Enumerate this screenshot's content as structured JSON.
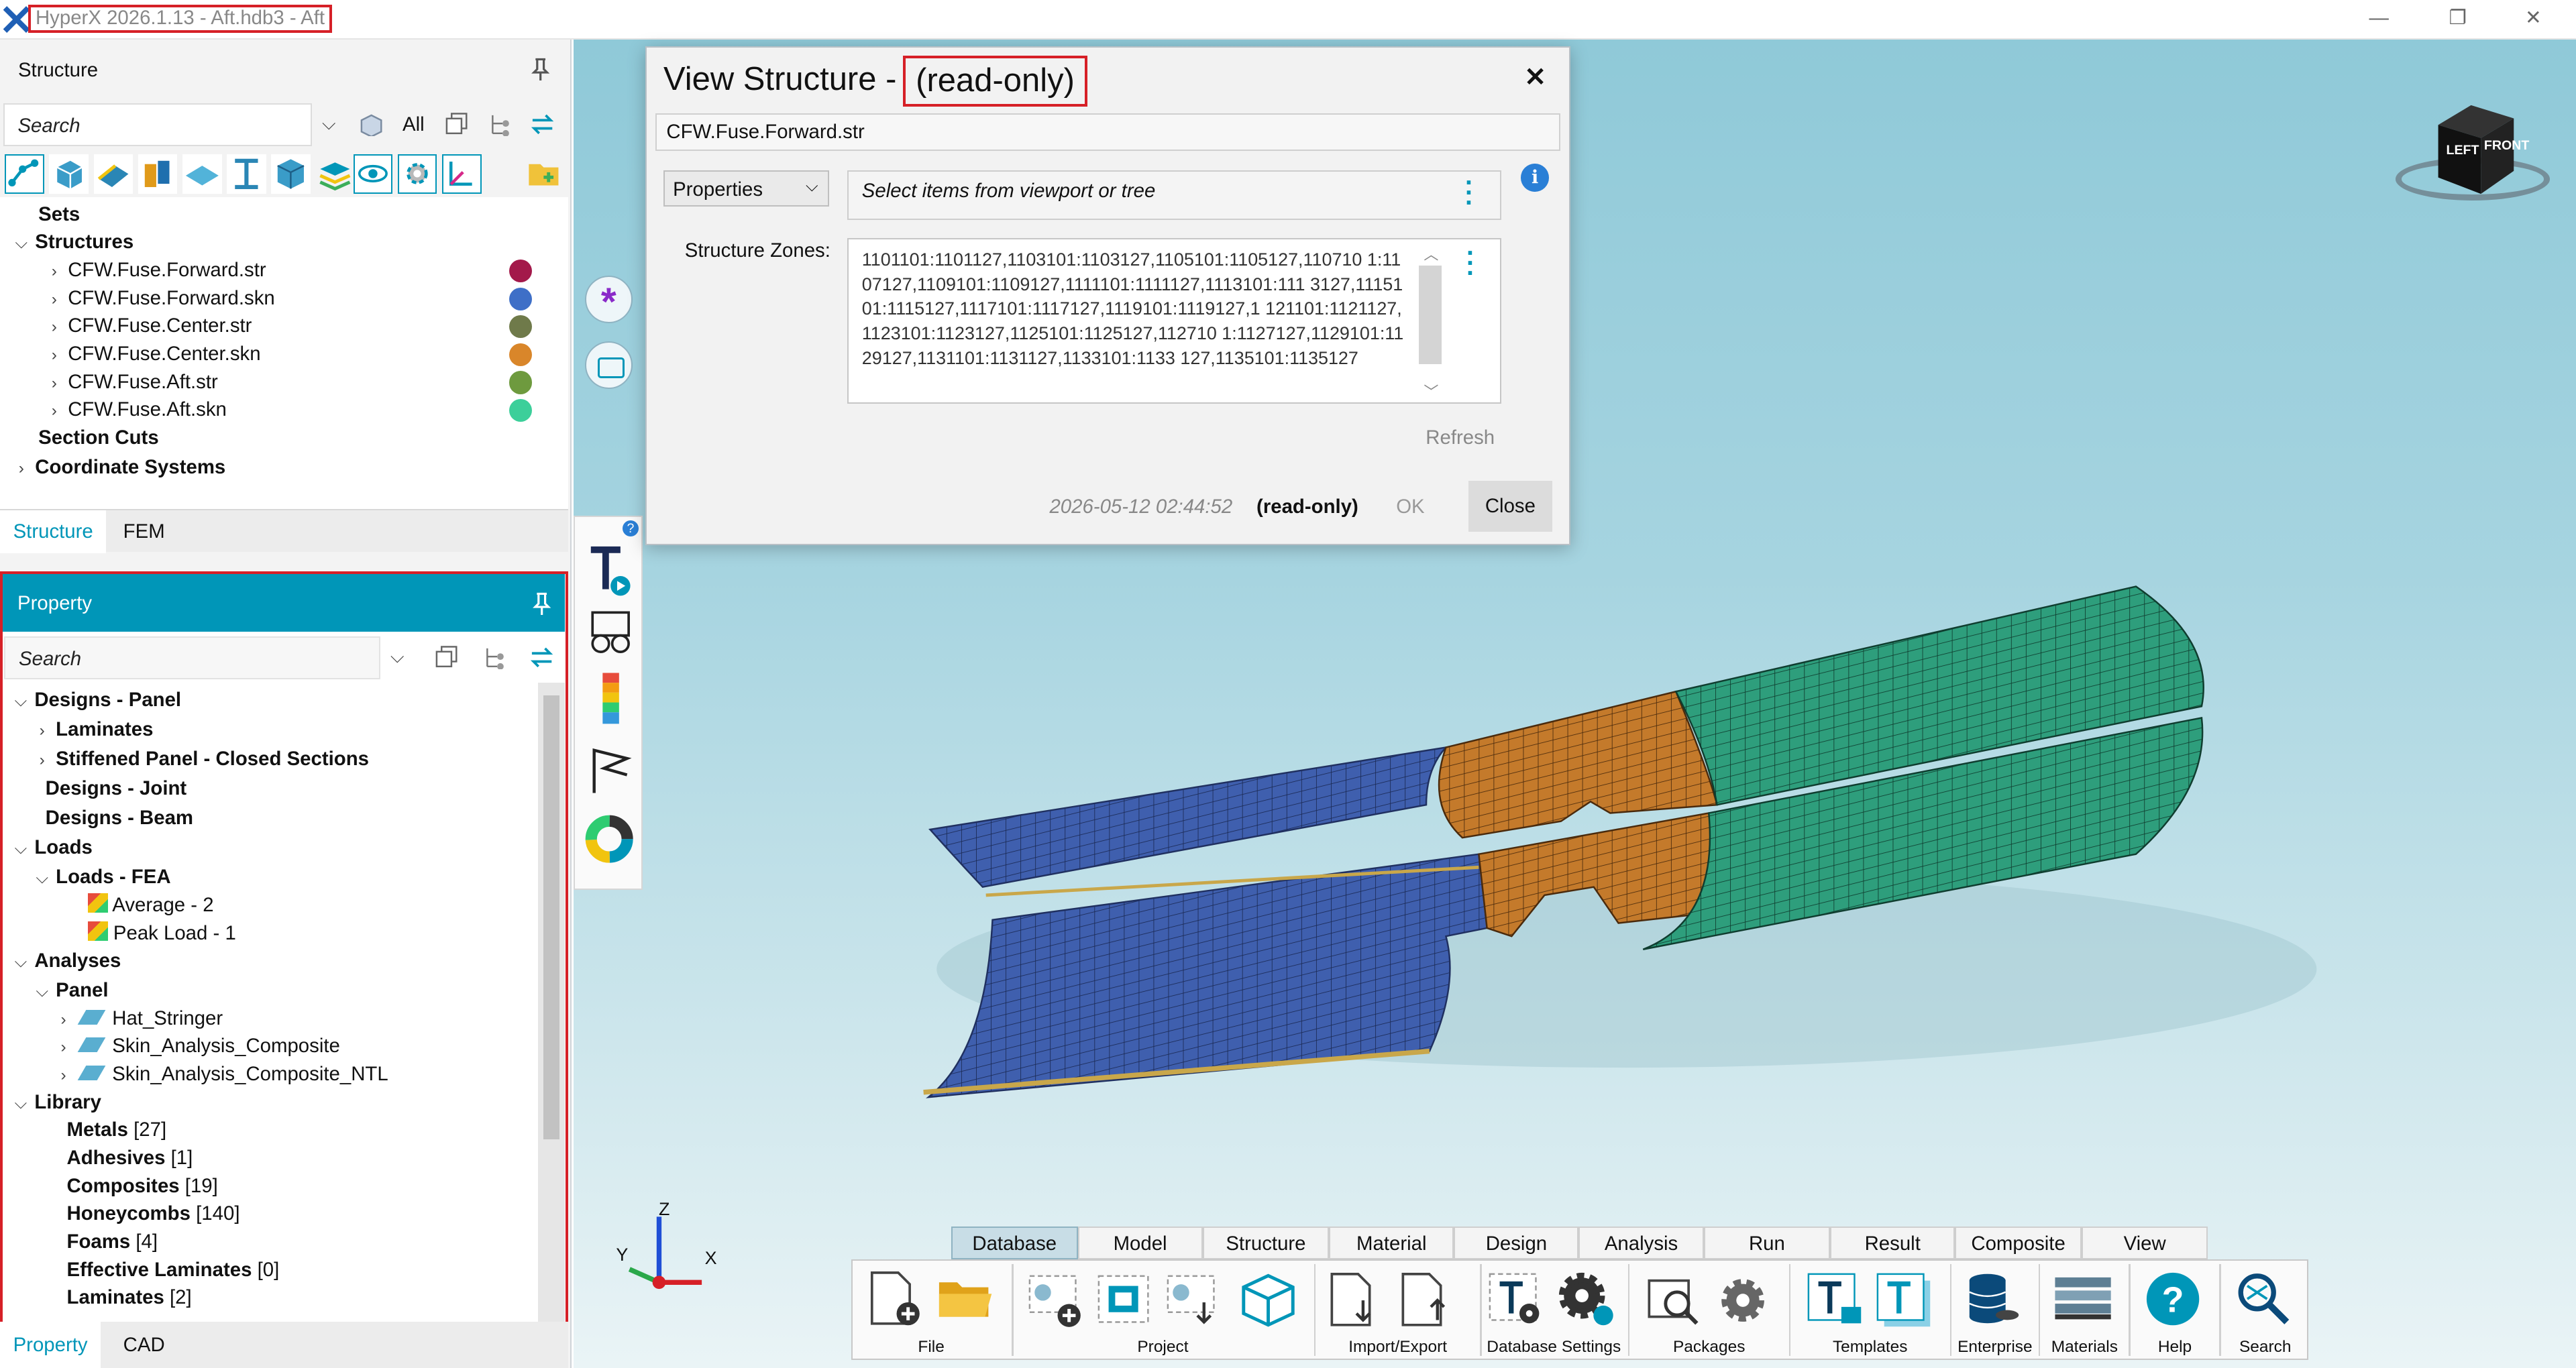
{
  "app": {
    "title": "HyperX 2026.1.13 - Aft.hdb3 - Aft"
  },
  "structure_panel": {
    "title": "Structure",
    "search_placeholder": "Search",
    "all_label": "All",
    "tree": {
      "sets": "Sets",
      "structures": "Structures",
      "items": [
        {
          "label": "CFW.Fuse.Forward.str",
          "color": "#a3194a"
        },
        {
          "label": "CFW.Fuse.Forward.skn",
          "color": "#3e6fc7"
        },
        {
          "label": "CFW.Fuse.Center.str",
          "color": "#6f7a4a"
        },
        {
          "label": "CFW.Fuse.Center.skn",
          "color": "#d9862a"
        },
        {
          "label": "CFW.Fuse.Aft.str",
          "color": "#6e9a3e"
        },
        {
          "label": "CFW.Fuse.Aft.skn",
          "color": "#3ccf9a"
        }
      ],
      "section_cuts": "Section Cuts",
      "coordinate_systems": "Coordinate Systems"
    },
    "tabs": [
      "Structure",
      "FEM"
    ]
  },
  "property_panel": {
    "title": "Property",
    "search_placeholder": "Search",
    "tree": [
      "Designs - Panel",
      "Laminates",
      "Stiffened Panel - Closed Sections",
      "Designs - Joint",
      "Designs - Beam",
      "Loads",
      "Loads - FEA",
      "Average - 2",
      "Peak Load - 1",
      "Analyses",
      "Panel",
      "Hat_Stringer",
      "Skin_Analysis_Composite",
      "Skin_Analysis_Composite_NTL",
      "Library"
    ],
    "library": [
      {
        "name": "Metals",
        "count": "[27]"
      },
      {
        "name": "Adhesives",
        "count": "[1]"
      },
      {
        "name": "Composites",
        "count": "[19]"
      },
      {
        "name": "Honeycombs",
        "count": "[140]"
      },
      {
        "name": "Foams",
        "count": "[4]"
      },
      {
        "name": "Effective Laminates",
        "count": "[0]"
      },
      {
        "name": "Laminates",
        "count": "[2]"
      }
    ],
    "tabs": [
      "Property",
      "CAD"
    ]
  },
  "dialog": {
    "title": "View Structure - ",
    "title_tag": "(read-only)",
    "name": "CFW.Fuse.Forward.str",
    "dropdown": "Properties",
    "select_hint": "Select items from viewport or tree",
    "zones_label": "Structure Zones:",
    "zones_text": "1101101:1101127,1103101:1103127,1105101:1105127,110710 1:1107127,1109101:1109127,1111101:1111127,1113101:111 3127,1115101:1115127,1117101:1117127,1119101:1119127,1 121101:1121127,1123101:1123127,1125101:1125127,112710 1:1127127,1129101:1129127,1131101:1131127,1133101:1133 127,1135101:1135127",
    "refresh": "Refresh",
    "timestamp": "2026-05-12 02:44:52",
    "readonly": "(read-only)",
    "ok": "OK",
    "close": "Close"
  },
  "viewcube": {
    "left": "LEFT",
    "front": "FRONT"
  },
  "axes": {
    "x": "X",
    "y": "Y",
    "z": "Z"
  },
  "ribbon": {
    "tabs": [
      "Database",
      "Model",
      "Structure",
      "Material",
      "Design",
      "Analysis",
      "Run",
      "Result",
      "Composite",
      "View"
    ],
    "groups": [
      "File",
      "Project",
      "Import/Export",
      "Database Settings",
      "Packages",
      "Templates",
      "Enterprise",
      "Materials",
      "Help",
      "Search"
    ]
  },
  "colors": {
    "accent": "#0096b8",
    "highlight": "#d62027",
    "forward": "#3e6fc7",
    "center": "#c9782a",
    "aft": "#2fa882"
  }
}
